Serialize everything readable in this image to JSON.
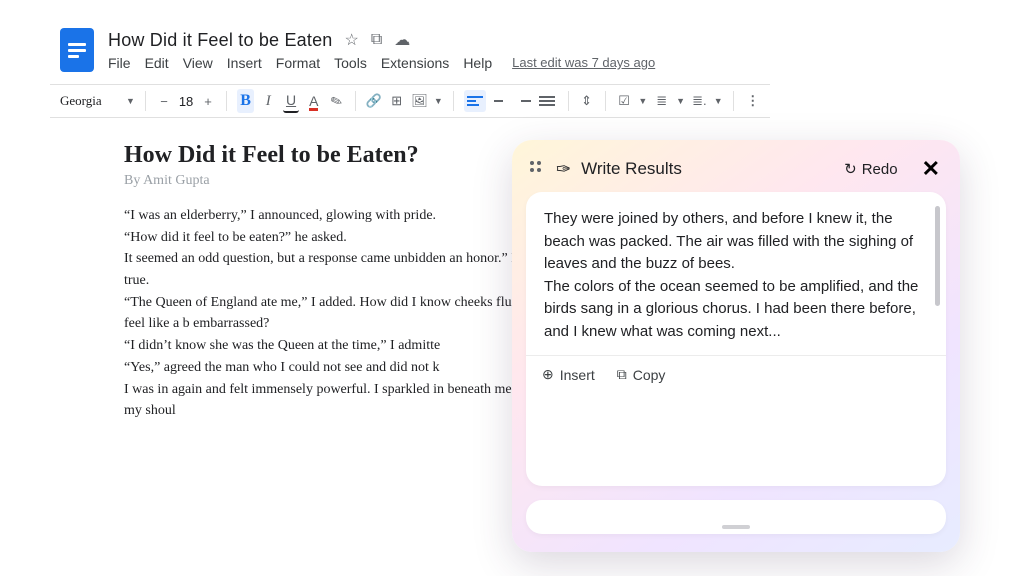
{
  "doc": {
    "title": "How Did it Feel to be Eaten",
    "menus": [
      "File",
      "Edit",
      "View",
      "Insert",
      "Format",
      "Tools",
      "Extensions",
      "Help"
    ],
    "last_edit": "Last edit was 7 days ago",
    "font_name": "Georgia",
    "font_size": "18",
    "heading": "How Did it Feel to be Eaten?",
    "byline": "By Amit Gupta",
    "body_html": "“I was an elderberry,” I announced, glowing with pride.\n“How did it feel to be eaten?” he asked.\nIt seemed an odd question, but a response came unbidden an honor.” My words surprised me, but they felt true.\n“The Queen of England ate me,” I added. How did I know cheeks flushed with embarrassment. I didn’t feel like a b embarrassed?\n“I didn’t know she was the Queen at the time,” I admitte\n“Yes,” agreed the man who I could not see and did not k\nI was in again and felt immensely powerful. I sparkled in beneath me rose, I stood, and I felt a caress on my shoul"
  },
  "toolbar": {
    "minus": "−",
    "plus": "+",
    "bold": "B",
    "italic": "I",
    "underline": "U",
    "fontcolor": "A",
    "highlight": "✎",
    "link": "🔗",
    "comment": "⊞",
    "image": "🖼",
    "linespace": "⇕",
    "checklist": "☑",
    "bulleted": "≣",
    "numbered": "≣.",
    "more": "⋮"
  },
  "ai": {
    "panel_title": "Write Results",
    "redo": "Redo",
    "para1": "They were joined by others, and before I knew it, the beach was packed. The air was filled with the sighing of leaves and the buzz of bees.",
    "para2": "The colors of the ocean seemed to be amplified, and the birds sang in a glorious chorus. I had been there before, and I knew what was coming next...",
    "insert": "Insert",
    "copy": "Copy"
  }
}
